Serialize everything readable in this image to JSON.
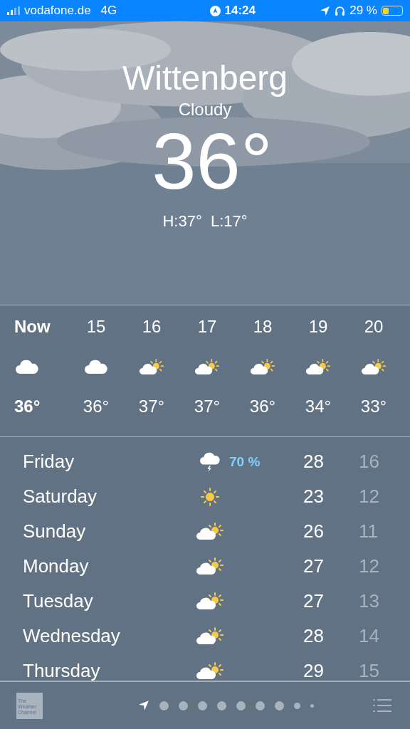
{
  "status_bar": {
    "carrier": "vodafone.de",
    "network": "4G",
    "time": "14:24",
    "battery_text": "29 %"
  },
  "current": {
    "city": "Wittenberg",
    "condition": "Cloudy",
    "temperature": "36°",
    "high_low": "H:37°  L:17°"
  },
  "hourly": [
    {
      "time": "Now",
      "kind": "cloud",
      "temp": "36°",
      "selected": true
    },
    {
      "time": "15",
      "kind": "cloud",
      "temp": "36°",
      "selected": false
    },
    {
      "time": "16",
      "kind": "partly-sunny",
      "temp": "37°",
      "selected": false
    },
    {
      "time": "17",
      "kind": "partly-sunny",
      "temp": "37°",
      "selected": false
    },
    {
      "time": "18",
      "kind": "partly-sunny",
      "temp": "36°",
      "selected": false
    },
    {
      "time": "19",
      "kind": "partly-sunny",
      "temp": "34°",
      "selected": false
    },
    {
      "time": "20",
      "kind": "partly-sunny",
      "temp": "33°",
      "selected": false
    }
  ],
  "daily": [
    {
      "day": "Friday",
      "kind": "thunderstorm",
      "precipitation": "70 %",
      "high": "28",
      "low": "16"
    },
    {
      "day": "Saturday",
      "kind": "sun",
      "high": "23",
      "low": "12"
    },
    {
      "day": "Sunday",
      "kind": "partly-sunny",
      "high": "26",
      "low": "11"
    },
    {
      "day": "Monday",
      "kind": "partly-sunny",
      "high": "27",
      "low": "12"
    },
    {
      "day": "Tuesday",
      "kind": "partly-sunny",
      "high": "27",
      "low": "13"
    },
    {
      "day": "Wednesday",
      "kind": "partly-sunny",
      "high": "28",
      "low": "14"
    },
    {
      "day": "Thursday",
      "kind": "partly-sunny",
      "high": "29",
      "low": "15"
    }
  ],
  "bottom_bar": {
    "logo": "The\nWeather\nChannel",
    "pages": [
      {
        "kind": "location",
        "selected": true
      },
      {
        "kind": "dot",
        "selected": false
      },
      {
        "kind": "dot",
        "selected": false
      },
      {
        "kind": "dot",
        "selected": false
      },
      {
        "kind": "dot",
        "selected": false
      },
      {
        "kind": "dot",
        "selected": false
      },
      {
        "kind": "dot",
        "selected": false
      },
      {
        "kind": "dot",
        "selected": false
      },
      {
        "kind": "small-dot",
        "selected": false
      },
      {
        "kind": "tiny-dot",
        "selected": false
      }
    ]
  }
}
